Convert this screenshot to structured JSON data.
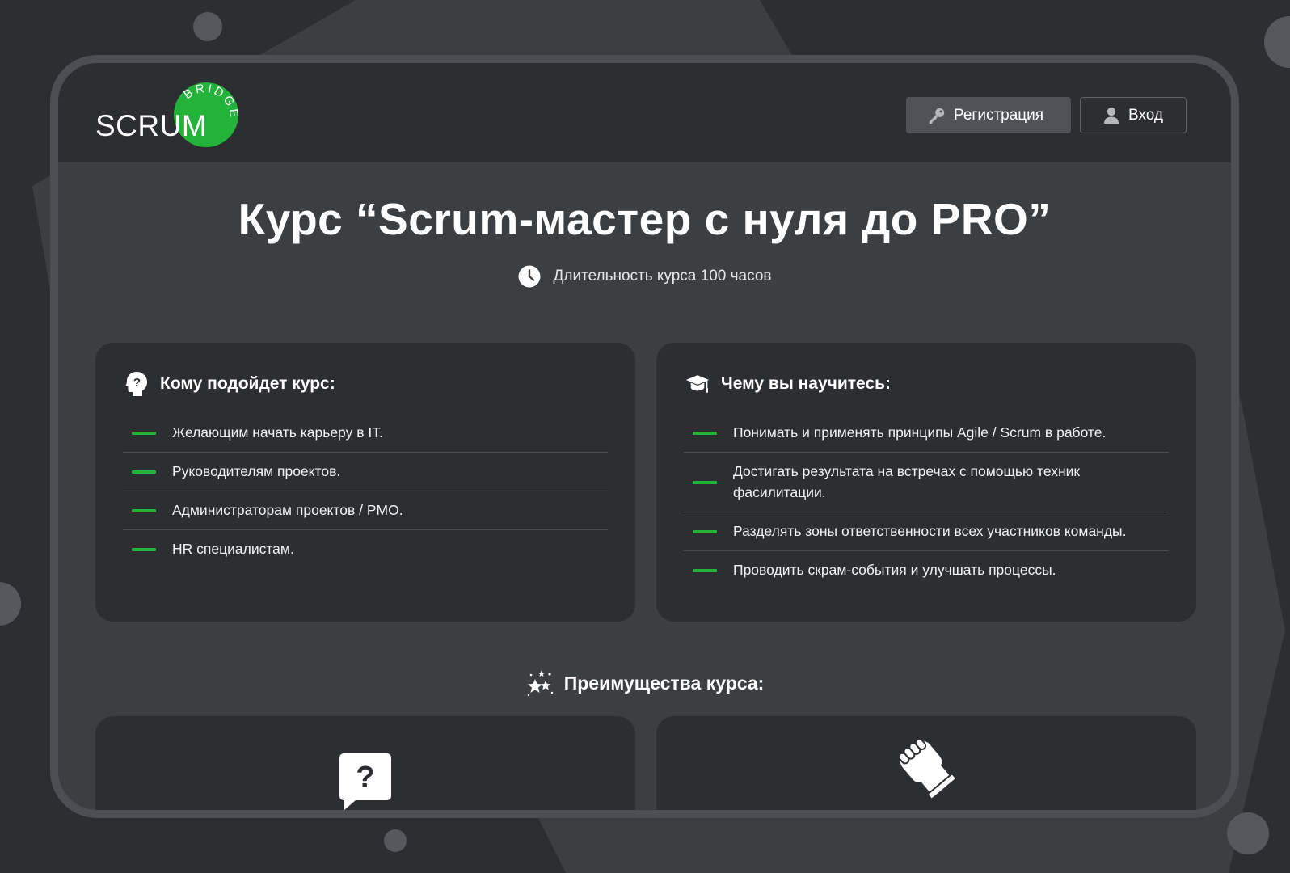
{
  "brand": {
    "logo_word": "SCRUM",
    "logo_arc": "BRIDGE",
    "accent": "#23b33a"
  },
  "header": {
    "register_label": "Регистрация",
    "login_label": "Вход",
    "register_icon": "key-icon",
    "login_icon": "user-icon"
  },
  "hero": {
    "title": "Курс “Scrum-мастер с нуля до PRO”",
    "duration": "Длительность курса 100 часов",
    "duration_icon": "clock-icon"
  },
  "audience": {
    "title": "Кому подойдет курс:",
    "icon": "head-question-icon",
    "items": [
      "Желающим начать карьеру в IT.",
      "Руководителям проектов.",
      "Администраторам проектов / PMO.",
      "HR специалистам."
    ]
  },
  "skills": {
    "title": "Чему вы научитесь:",
    "icon": "graduation-cap-icon",
    "items": [
      "Понимать и применять принципы Agile / Scrum в работе.",
      "Достигать результата на встречах с помощью техник фасилитации.",
      "Разделять зоны ответственности всех участников команды.",
      "Проводить скрам-события и улучшать процессы."
    ]
  },
  "advantages": {
    "title": "Преимущества курса:",
    "icon": "stars-icon",
    "cards": [
      {
        "icon": "question-bubble-icon"
      },
      {
        "icon": "handshake-icon"
      }
    ]
  }
}
